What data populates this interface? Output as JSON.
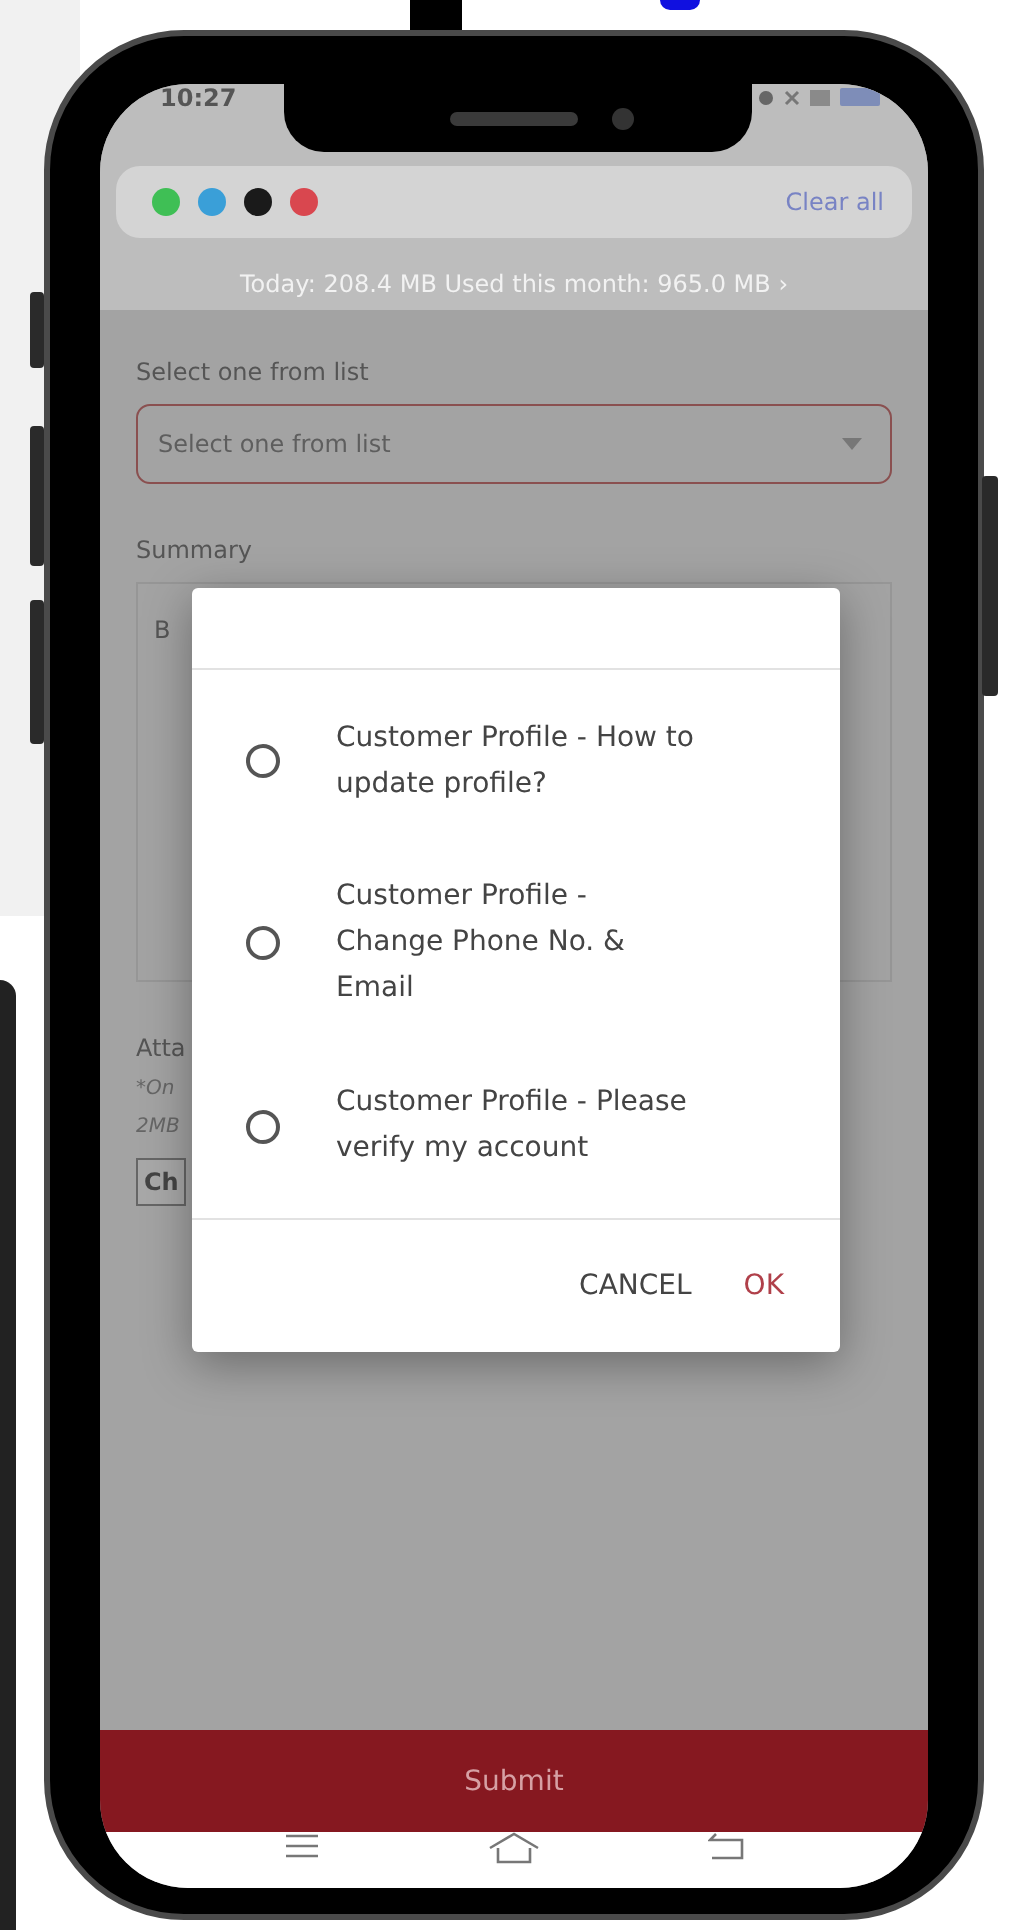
{
  "status_bar": {
    "time": "10:27"
  },
  "notification_bar": {
    "apps": [
      {
        "color": "#3fbf55"
      },
      {
        "color": "#3a9fd8"
      },
      {
        "color": "#1a1a1a"
      },
      {
        "color": "#d9474f"
      }
    ],
    "clear_all": "Clear all"
  },
  "data_usage": "Today: 208.4 MB Used this month: 965.0 MB ›",
  "form": {
    "select_label": "Select one from list",
    "select_placeholder": "Select one from list",
    "summary_label": "Summary",
    "summary_placeholder": "B",
    "attachment_label": "Atta",
    "attachment_notes": [
      "*On",
      "2MB"
    ],
    "choose_button": "Ch"
  },
  "dialog": {
    "options": [
      {
        "label": "Customer Profile - How to update profile?",
        "selected": false
      },
      {
        "label": "Customer Profile - Change Phone No. & Email",
        "selected": false
      },
      {
        "label": "Customer Profile - Please verify my account",
        "selected": false
      }
    ],
    "buttons": [
      {
        "label": "CANCEL",
        "kind": "neutral"
      },
      {
        "label": "OK",
        "kind": "primary"
      }
    ]
  },
  "submit": "Submit"
}
